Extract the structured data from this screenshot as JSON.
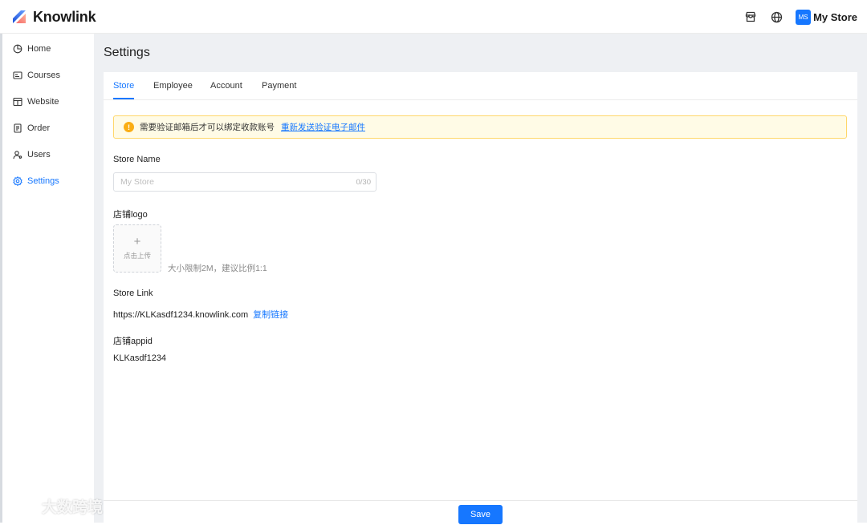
{
  "header": {
    "brand_name": "Knowlink",
    "store_avatar": "MS",
    "store_name": "My Store",
    "icons": [
      "store-icon",
      "globe-icon"
    ]
  },
  "sidebar": {
    "items": [
      {
        "label": "Home",
        "icon": "pie-chart-icon"
      },
      {
        "label": "Courses",
        "icon": "courses-icon"
      },
      {
        "label": "Website",
        "icon": "store-icon"
      },
      {
        "label": "Order",
        "icon": "order-icon"
      },
      {
        "label": "Users",
        "icon": "users-icon"
      },
      {
        "label": "Settings",
        "icon": "gear-icon",
        "active": true
      }
    ]
  },
  "page": {
    "title": "Settings",
    "tabs": [
      "Store",
      "Employee",
      "Account",
      "Payment"
    ],
    "active_tab": "Store"
  },
  "alert": {
    "text": "需要验证邮箱后才可以绑定收款账号",
    "link": "重新发送验证电子邮件"
  },
  "form": {
    "store_name_label": "Store Name",
    "store_name_placeholder": "My Store",
    "store_name_count": "0/30",
    "logo_label": "店铺logo",
    "upload_plus": "+",
    "upload_text": "点击上传",
    "upload_hint": "大小限制2M，建议比例1:1",
    "store_link_label": "Store Link",
    "store_link_value": "https://KLKasdf1234.knowlink.com",
    "copy_link": "复制链接",
    "appid_label": "店铺appid",
    "appid_value": "KLKasdf1234"
  },
  "footer": {
    "save_label": "Save"
  },
  "watermark": {
    "text": "大数跨境"
  },
  "colors": {
    "primary": "#1677ff",
    "warning": "#faad14",
    "warning_bg": "#fffbe6",
    "page_bg": "#eef0f3"
  }
}
